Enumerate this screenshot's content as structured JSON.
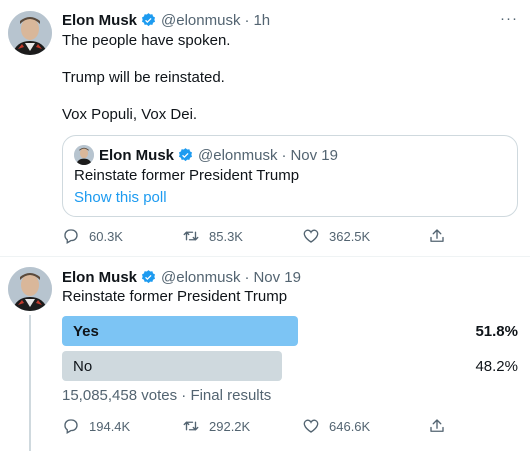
{
  "tweet1": {
    "name": "Elon Musk",
    "handle": "@elonmusk",
    "dot": "·",
    "time": "1h",
    "more": "···",
    "paragraphs": [
      "The people have spoken.",
      "Trump will be reinstated.",
      "Vox Populi, Vox Dei."
    ],
    "quote": {
      "name": "Elon Musk",
      "handle": "@elonmusk",
      "dot": "·",
      "time": "Nov 19",
      "text": "Reinstate former President Trump",
      "link": "Show this poll"
    },
    "actions": {
      "replies": "60.3K",
      "retweets": "85.3K",
      "likes": "362.5K"
    }
  },
  "tweet2": {
    "name": "Elon Musk",
    "handle": "@elonmusk",
    "dot": "·",
    "time": "Nov 19",
    "text": "Reinstate former President Trump",
    "poll": {
      "options": [
        {
          "label": "Yes",
          "percent": "51.8%",
          "share": 0.518,
          "winner": true
        },
        {
          "label": "No",
          "percent": "48.2%",
          "share": 0.482,
          "winner": false
        }
      ],
      "votes": "15,085,458 votes",
      "dot": "·",
      "status": "Final results"
    },
    "actions": {
      "replies": "194.4K",
      "retweets": "292.2K",
      "likes": "646.6K"
    }
  },
  "colors": {
    "accent": "#1d9bf0",
    "winner_bar": "#7cc4f4",
    "loser_bar": "#cfd9de",
    "muted": "#536471"
  },
  "icons": [
    "verified-icon",
    "reply-icon",
    "retweet-icon",
    "like-icon",
    "share-icon",
    "more-icon"
  ]
}
